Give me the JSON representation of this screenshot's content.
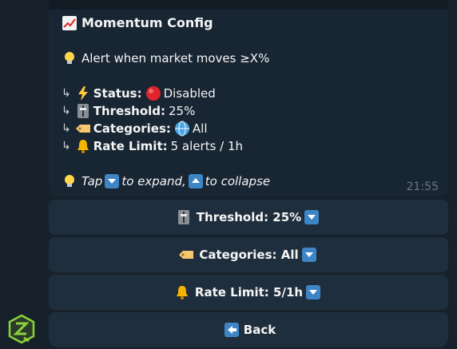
{
  "message": {
    "title": "Momentum Config",
    "description": "Alert when market moves ≥X%",
    "arrow": "↳",
    "status_label": "Status:",
    "status_value": "Disabled",
    "threshold_label": "Threshold:",
    "threshold_value": "25%",
    "categories_label": "Categories:",
    "categories_value": "All",
    "rate_label": "Rate Limit:",
    "rate_value": "5 alerts / 1h",
    "hint_tap": "Tap",
    "hint_expand": "to expand,",
    "hint_collapse": "to collapse",
    "time": "21:55"
  },
  "keyboard": {
    "threshold_btn": "Threshold: 25%",
    "categories_btn": "Categories: All",
    "rate_btn": "Rate Limit: 5/1h",
    "back_btn": "Back"
  },
  "icons": {
    "chart": "chart-increasing-icon",
    "bulb": "light-bulb-icon",
    "status": "high-voltage-icon",
    "disabled": "red-circle-icon",
    "threshold": "control-knobs-icon",
    "categories": "label-tag-icon",
    "globe": "globe-icon",
    "rate": "bell-icon",
    "down": "down-arrow-button-icon",
    "up": "up-arrow-button-icon",
    "back": "left-arrow-button-icon"
  },
  "colors": {
    "background": "#17212b",
    "bubble": "#182533",
    "button": "#1f2e3d",
    "key_blue": "#3e85c6",
    "time": "#6c7883",
    "disabled_red": "#e0242a"
  }
}
